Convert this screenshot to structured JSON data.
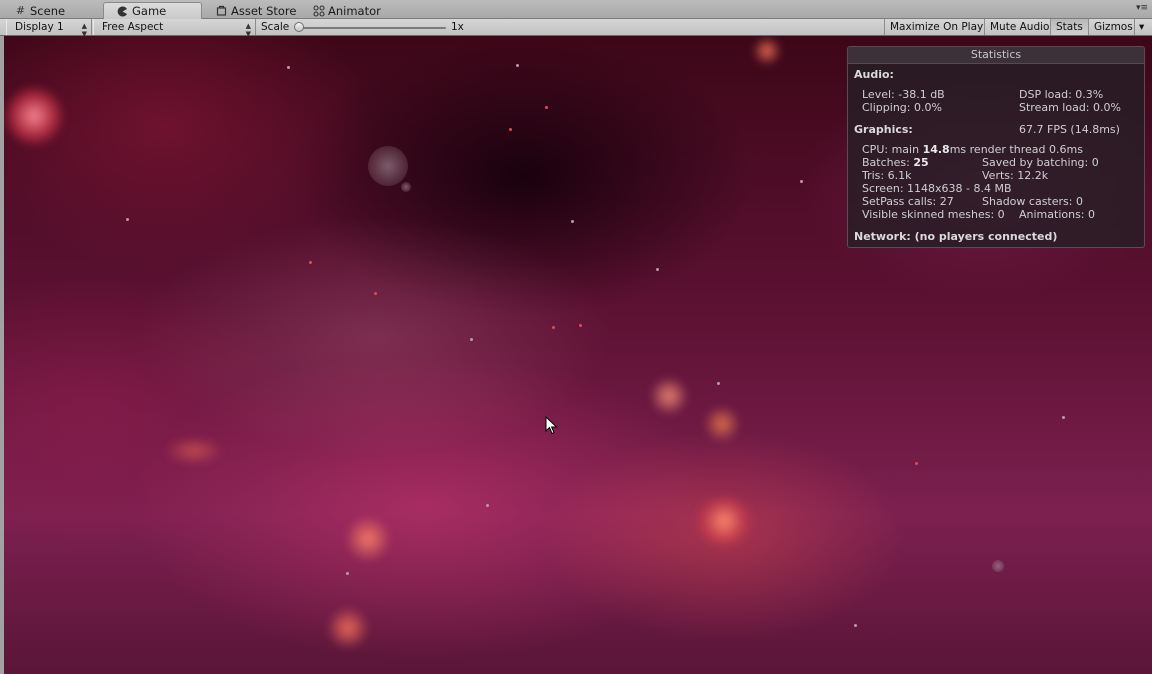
{
  "tabs": [
    {
      "label": "Scene",
      "icon": "grid-icon"
    },
    {
      "label": "Game",
      "icon": "pacman-icon",
      "active": true
    },
    {
      "label": "Asset Store",
      "icon": "store-icon"
    },
    {
      "label": "Animator",
      "icon": "animator-icon"
    }
  ],
  "toolbar": {
    "display": "Display 1",
    "aspect": "Free Aspect",
    "scale_label": "Scale",
    "scale_value": "1x",
    "maximize_on_play": "Maximize On Play",
    "mute_audio": "Mute Audio",
    "stats": "Stats",
    "gizmos": "Gizmos"
  },
  "statistics": {
    "title": "Statistics",
    "audio_header": "Audio:",
    "level": "Level: -38.1 dB",
    "dsp_load": "DSP load: 0.3%",
    "clipping": "Clipping: 0.0%",
    "stream_load": "Stream load: 0.0%",
    "graphics_header": "Graphics:",
    "fps": "67.7 FPS (14.8ms)",
    "cpu_prefix": "CPU: main ",
    "cpu_main": "14.8",
    "cpu_suffix": "ms  render thread 0.6ms",
    "batches_prefix": "Batches: ",
    "batches": "25",
    "saved_by_batching": "Saved by batching: 0",
    "tris": "Tris: 6.1k",
    "verts": "Verts: 12.2k",
    "screen": "Screen: 1148x638 - 8.4 MB",
    "setpass": "SetPass calls: 27",
    "shadow_casters": "Shadow casters: 0",
    "skinned_meshes": "Visible skinned meshes: 0",
    "animations": "Animations: 0",
    "network": "Network: (no players connected)"
  },
  "colors": {
    "accent": "#5e1234",
    "panel_bg": "#261e24",
    "editor_chrome": "#c2c2c2"
  }
}
